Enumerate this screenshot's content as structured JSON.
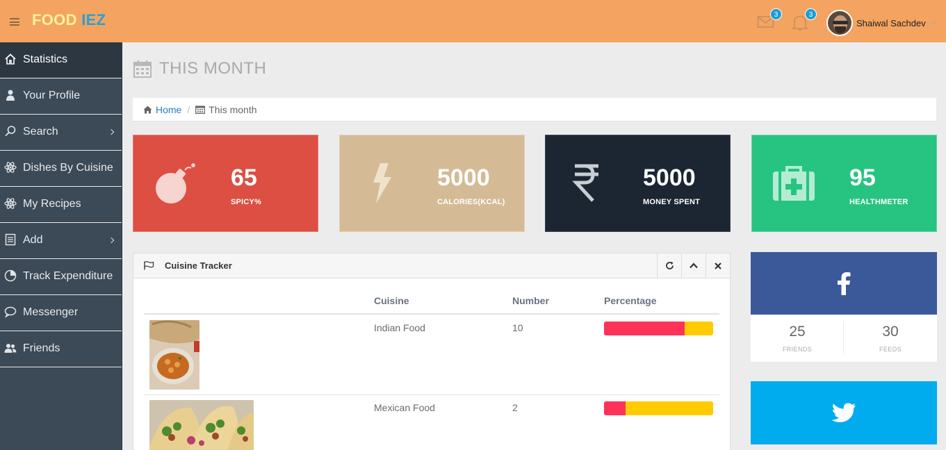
{
  "header": {
    "brand_part1": "FOOD",
    "brand_part2": "IEZ",
    "mail_count": "3",
    "notification_count": "3",
    "user_name": "Shaiwal Sachdev"
  },
  "sidebar": {
    "items": [
      {
        "label": "Statistics",
        "icon": "home-icon"
      },
      {
        "label": "Your Profile",
        "icon": "user-icon"
      },
      {
        "label": "Search",
        "icon": "search-icon"
      },
      {
        "label": "Dishes By Cuisine",
        "icon": "atom-icon"
      },
      {
        "label": "My Recipes",
        "icon": "atom-icon"
      },
      {
        "label": "Add",
        "icon": "list-icon"
      },
      {
        "label": "Track Expenditure",
        "icon": "pie-chart-icon"
      },
      {
        "label": "Messenger",
        "icon": "chat-icon"
      },
      {
        "label": "Friends",
        "icon": "users-icon"
      }
    ]
  },
  "page": {
    "title": "THIS MONTH",
    "breadcrumb_home": "Home",
    "breadcrumb_current": "This month"
  },
  "stats": [
    {
      "value": "65",
      "label": "SPICY%",
      "icon": "bomb-icon",
      "color": "#dc4f42"
    },
    {
      "value": "5000",
      "label": "CALORIES(KCAL)",
      "icon": "lightning-icon",
      "color": "#d4bb95"
    },
    {
      "value": "5000",
      "label": "MONEY SPENT",
      "icon": "rupee-icon",
      "color": "#1c2532"
    },
    {
      "value": "95",
      "label": "HEALTHMETER",
      "icon": "medkit-icon",
      "color": "#27c481"
    }
  ],
  "cuisine_tracker": {
    "title": "Cuisine Tracker",
    "columns": [
      "Cuisine",
      "Number",
      "Percentage"
    ],
    "rows": [
      {
        "cuisine": "Indian Food",
        "number": "10",
        "red_fraction": 0.74
      },
      {
        "cuisine": "Mexican Food",
        "number": "2",
        "red_fraction": 0.2
      }
    ]
  },
  "facebook": {
    "friends_value": "25",
    "friends_label": "FRIENDS",
    "feeds_value": "30",
    "feeds_label": "FEEDS"
  },
  "colors": {
    "header": "#f4a460",
    "sidebar": "#3c4956",
    "facebook": "#3b5998",
    "twitter": "#00acee",
    "bar_red": "#ff3259",
    "bar_yellow": "#ffcc00"
  }
}
